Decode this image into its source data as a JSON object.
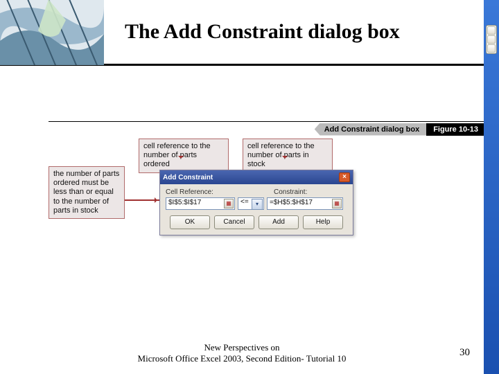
{
  "header": {
    "title": "The Add Constraint dialog box"
  },
  "figure": {
    "label": "Add Constraint dialog box",
    "number": "Figure 10-13"
  },
  "callouts": {
    "left": "the number of parts ordered must be less than or equal to the number of parts in stock",
    "top1": "cell reference to the number of parts ordered",
    "top2": "cell reference to the number of parts in stock"
  },
  "dialog": {
    "title": "Add Constraint",
    "cellref_label": "Cell Reference:",
    "constraint_label": "Constraint:",
    "cellref_value": "$I$5:$I$17",
    "operator": "<=",
    "constraint_value": "=$H$5:$H$17",
    "buttons": {
      "ok": "OK",
      "cancel": "Cancel",
      "add": "Add",
      "help": "Help"
    }
  },
  "footer": {
    "line1": "New Perspectives on",
    "line2": "Microsoft Office Excel 2003, Second Edition- Tutorial 10",
    "page": "30"
  }
}
